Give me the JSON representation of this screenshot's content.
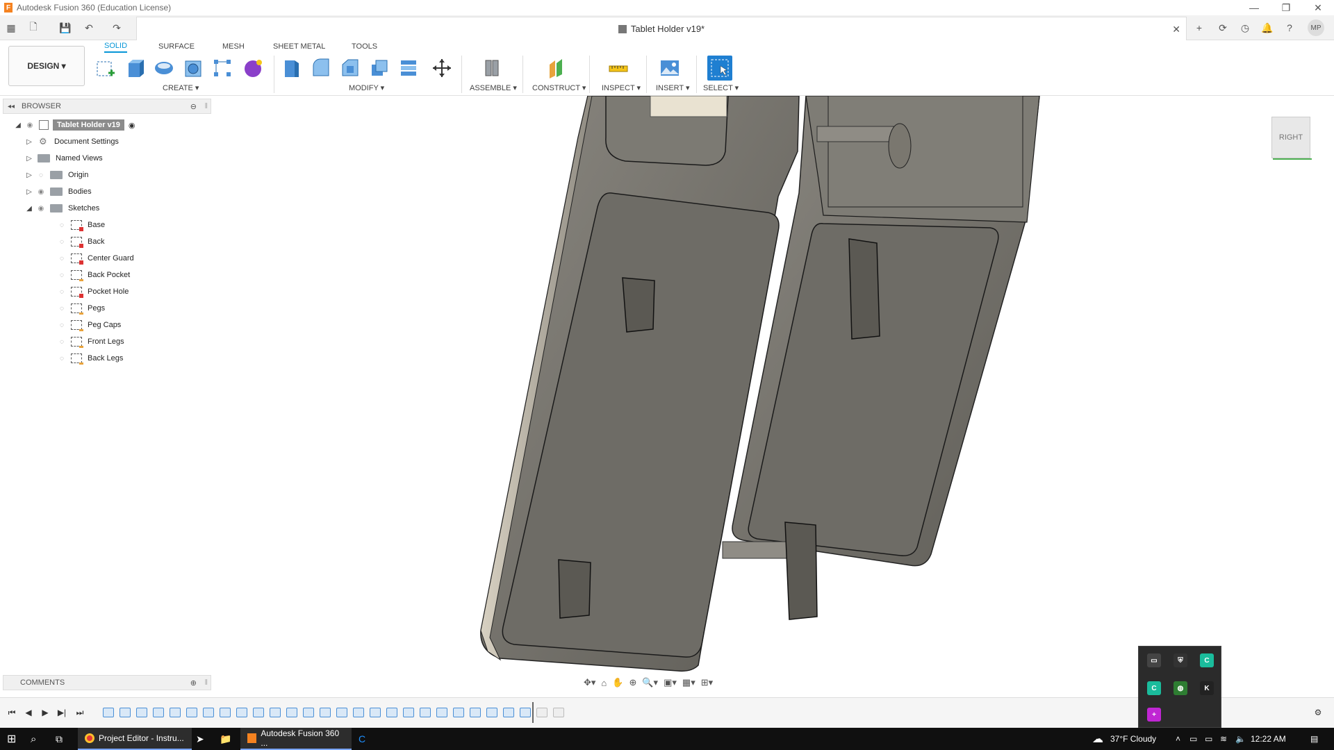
{
  "window": {
    "title": "Autodesk Fusion 360 (Education License)",
    "logo_letter": "F",
    "minimize": "—",
    "restore": "❐",
    "close": "✕"
  },
  "tabbar": {
    "doc_title": "Tablet Holder v19*",
    "close": "✕",
    "new_tab": "+",
    "user_initials": "MP",
    "help": "?"
  },
  "toolbar": {
    "design_label": "DESIGN ▾",
    "tabs": [
      "SOLID",
      "SURFACE",
      "MESH",
      "SHEET METAL",
      "TOOLS"
    ],
    "groups": {
      "create": "CREATE ▾",
      "modify": "MODIFY ▾",
      "assemble": "ASSEMBLE ▾",
      "construct": "CONSTRUCT ▾",
      "inspect": "INSPECT ▾",
      "insert": "INSERT ▾",
      "select": "SELECT ▾"
    }
  },
  "browser": {
    "header": "BROWSER",
    "root": "Tablet Holder v19",
    "items": [
      "Document Settings",
      "Named Views",
      "Origin",
      "Bodies",
      "Sketches"
    ],
    "sketches": [
      "Base",
      "Back",
      "Center Guard",
      "Back Pocket",
      "Pocket Hole",
      "Pegs",
      "Peg Caps",
      "Front Legs",
      "Back Legs"
    ]
  },
  "comments": {
    "label": "COMMENTS"
  },
  "viewcube": {
    "face": "RIGHT"
  },
  "taskbar": {
    "apps": [
      "Project Editor - Instru...",
      "Autodesk Fusion 360 ..."
    ],
    "weather": "37°F  Cloudy",
    "time": "12:22 AM"
  },
  "colors": {
    "accent": "#0696d7",
    "model": "#7a776f"
  }
}
